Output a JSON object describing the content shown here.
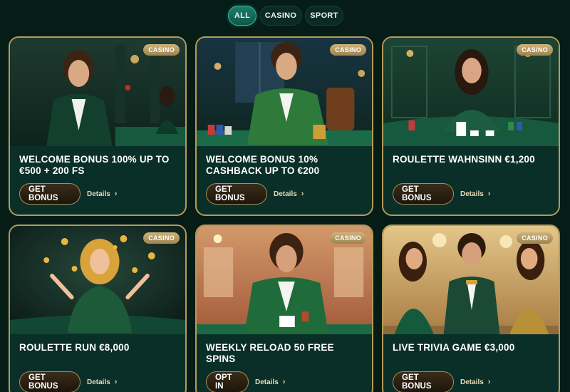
{
  "tabs": [
    {
      "label": "ALL",
      "active": true
    },
    {
      "label": "CASINO",
      "active": false
    },
    {
      "label": "SPORT",
      "active": false
    }
  ],
  "cards": [
    {
      "badge": "CASINO",
      "title": "WELCOME BONUS 100% UP TO €500 + 200 FS",
      "button": "GET BONUS",
      "details": "Details",
      "chevron": "›",
      "image": "man-in-tuxedo-at-casino-table-illustration"
    },
    {
      "badge": "CASINO",
      "title": "WELCOME BONUS 10% CASHBACK UP TO €200",
      "button": "GET BONUS",
      "details": "Details",
      "chevron": "›",
      "image": "man-with-poker-chips-illustration"
    },
    {
      "badge": "CASINO",
      "title": "ROULETTE WAHNSINN €1,200",
      "button": "GET BONUS",
      "details": "Details",
      "chevron": "›",
      "image": "woman-dealing-cards-illustration"
    },
    {
      "badge": "CASINO",
      "title": "ROULETTE RUN €8,000",
      "button": "GET BONUS",
      "details": "Details",
      "chevron": "›",
      "image": "woman-with-flying-coins-illustration"
    },
    {
      "badge": "CASINO",
      "title": "WEEKLY RELOAD 50 FREE SPINS",
      "button": "OPT IN",
      "details": "Details",
      "chevron": "›",
      "image": "man-holding-cards-illustration"
    },
    {
      "badge": "CASINO",
      "title": "LIVE TRIVIA GAME €3,000",
      "button": "GET BONUS",
      "details": "Details",
      "chevron": "›",
      "image": "three-people-casino-illustration"
    }
  ],
  "colors": {
    "background": "#051c17",
    "card": "#0a2f28",
    "card_border": "#b59a58",
    "tab_active": "#1a7d6a",
    "badge": "#b79c64"
  }
}
